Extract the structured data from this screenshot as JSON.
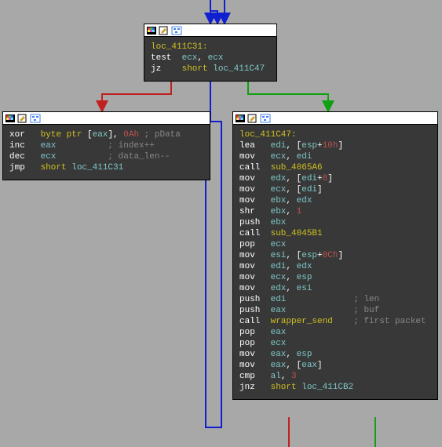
{
  "block_top": {
    "lines": [
      {
        "label": "loc_411C31:"
      },
      {
        "mn": "test",
        "ops": [
          [
            "reg",
            "ecx"
          ],
          [
            "p",
            ", "
          ],
          [
            "reg",
            "ecx"
          ]
        ]
      },
      {
        "mn": "jz",
        "ops": [
          [
            "kw",
            "short "
          ],
          [
            "loc",
            "loc_411C47"
          ]
        ]
      }
    ]
  },
  "block_left": {
    "lines": [
      {
        "mn": "xor",
        "ops": [
          [
            "kw",
            "byte ptr "
          ],
          [
            "p",
            "["
          ],
          [
            "reg",
            "eax"
          ],
          [
            "p",
            "], "
          ],
          [
            "num",
            "0Ah"
          ],
          [
            "cmt",
            " ; pData"
          ]
        ]
      },
      {
        "mn": "inc",
        "ops": [
          [
            "reg",
            "eax"
          ],
          [
            "cmt",
            "          ; index++"
          ]
        ]
      },
      {
        "mn": "dec",
        "ops": [
          [
            "reg",
            "ecx"
          ],
          [
            "cmt",
            "          ; data_len--"
          ]
        ]
      },
      {
        "mn": "jmp",
        "ops": [
          [
            "kw",
            "short "
          ],
          [
            "loc",
            "loc_411C31"
          ]
        ]
      }
    ]
  },
  "block_right": {
    "lines": [
      {
        "label": "loc_411C47:"
      },
      {
        "mn": "lea",
        "ops": [
          [
            "reg",
            "edi"
          ],
          [
            "p",
            ", ["
          ],
          [
            "reg",
            "esp"
          ],
          [
            "p",
            "+"
          ],
          [
            "num",
            "10h"
          ],
          [
            "p",
            "]"
          ]
        ]
      },
      {
        "mn": "mov",
        "ops": [
          [
            "reg",
            "ecx"
          ],
          [
            "p",
            ", "
          ],
          [
            "reg",
            "edi"
          ]
        ]
      },
      {
        "mn": "call",
        "ops": [
          [
            "lbl",
            "sub_4065A6"
          ]
        ]
      },
      {
        "mn": "mov",
        "ops": [
          [
            "reg",
            "edx"
          ],
          [
            "p",
            ", ["
          ],
          [
            "reg",
            "edi"
          ],
          [
            "p",
            "+"
          ],
          [
            "num",
            "8"
          ],
          [
            "p",
            "]"
          ]
        ]
      },
      {
        "mn": "mov",
        "ops": [
          [
            "reg",
            "ecx"
          ],
          [
            "p",
            ", ["
          ],
          [
            "reg",
            "edi"
          ],
          [
            "p",
            "]"
          ]
        ]
      },
      {
        "mn": "mov",
        "ops": [
          [
            "reg",
            "ebx"
          ],
          [
            "p",
            ", "
          ],
          [
            "reg",
            "edx"
          ]
        ]
      },
      {
        "mn": "shr",
        "ops": [
          [
            "reg",
            "ebx"
          ],
          [
            "p",
            ", "
          ],
          [
            "num",
            "1"
          ]
        ]
      },
      {
        "mn": "push",
        "ops": [
          [
            "reg",
            "ebx"
          ]
        ]
      },
      {
        "mn": "call",
        "ops": [
          [
            "lbl",
            "sub_4045B1"
          ]
        ]
      },
      {
        "mn": "pop",
        "ops": [
          [
            "reg",
            "ecx"
          ]
        ]
      },
      {
        "mn": "mov",
        "ops": [
          [
            "reg",
            "esi"
          ],
          [
            "p",
            ", ["
          ],
          [
            "reg",
            "esp"
          ],
          [
            "p",
            "+"
          ],
          [
            "num",
            "0Ch"
          ],
          [
            "p",
            "]"
          ]
        ]
      },
      {
        "mn": "mov",
        "ops": [
          [
            "reg",
            "edi"
          ],
          [
            "p",
            ", "
          ],
          [
            "reg",
            "edx"
          ]
        ]
      },
      {
        "mn": "mov",
        "ops": [
          [
            "reg",
            "ecx"
          ],
          [
            "p",
            ", "
          ],
          [
            "reg",
            "esp"
          ]
        ]
      },
      {
        "mn": "mov",
        "ops": [
          [
            "reg",
            "edx"
          ],
          [
            "p",
            ", "
          ],
          [
            "reg",
            "esi"
          ]
        ]
      },
      {
        "mn": "push",
        "ops": [
          [
            "reg",
            "edi"
          ],
          [
            "cmt",
            "             ; len"
          ]
        ]
      },
      {
        "mn": "push",
        "ops": [
          [
            "reg",
            "eax"
          ],
          [
            "cmt",
            "             ; buf"
          ]
        ]
      },
      {
        "mn": "call",
        "ops": [
          [
            "lbl",
            "wrapper_send"
          ],
          [
            "cmt",
            "    ; first packet"
          ]
        ]
      },
      {
        "mn": "pop",
        "ops": [
          [
            "reg",
            "eax"
          ]
        ]
      },
      {
        "mn": "pop",
        "ops": [
          [
            "reg",
            "ecx"
          ]
        ]
      },
      {
        "mn": "mov",
        "ops": [
          [
            "reg",
            "eax"
          ],
          [
            "p",
            ", "
          ],
          [
            "reg",
            "esp"
          ]
        ]
      },
      {
        "mn": "mov",
        "ops": [
          [
            "reg",
            "eax"
          ],
          [
            "p",
            ", ["
          ],
          [
            "reg",
            "eax"
          ],
          [
            "p",
            "]"
          ]
        ]
      },
      {
        "mn": "cmp",
        "ops": [
          [
            "reg",
            "al"
          ],
          [
            "p",
            ", "
          ],
          [
            "num",
            "3"
          ]
        ]
      },
      {
        "mn": "jnz",
        "ops": [
          [
            "kw",
            "short "
          ],
          [
            "loc",
            "loc_411CB2"
          ]
        ]
      }
    ]
  },
  "icons": {
    "palette": "palette-icon",
    "edit": "edit-icon",
    "group": "group-icon"
  }
}
